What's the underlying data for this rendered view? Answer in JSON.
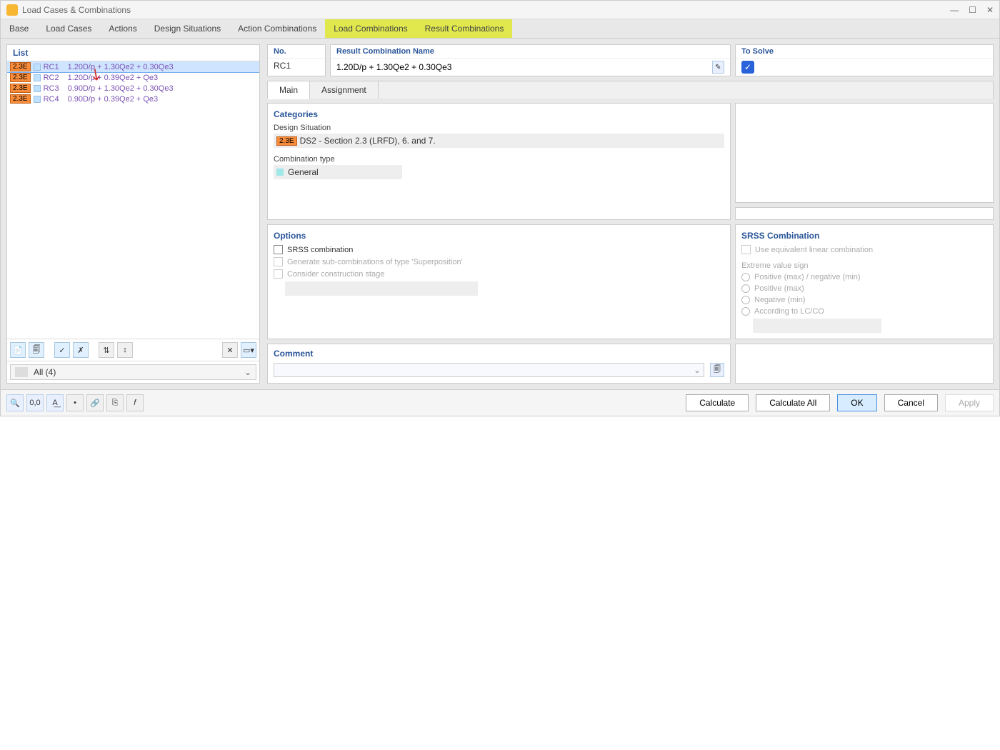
{
  "window_title": "Load Cases & Combinations",
  "main_tabs": [
    "Base",
    "Load Cases",
    "Actions",
    "Design Situations",
    "Action Combinations",
    "Load Combinations",
    "Result Combinations"
  ],
  "list": {
    "title": "List",
    "items": [
      {
        "badge": "2.3E",
        "id": "RC1",
        "desc": "1.20D/p + 1.30Qe2 + 0.30Qe3"
      },
      {
        "badge": "2.3E",
        "id": "RC2",
        "desc": "1.20D/p + 0.39Qe2 + Qe3"
      },
      {
        "badge": "2.3E",
        "id": "RC3",
        "desc": "0.90D/p + 1.30Qe2 + 0.30Qe3"
      },
      {
        "badge": "2.3E",
        "id": "RC4",
        "desc": "0.90D/p + 0.39Qe2 + Qe3"
      }
    ],
    "filter": "All (4)"
  },
  "header": {
    "no_label": "No.",
    "no_value": "RC1",
    "name_label": "Result Combination Name",
    "name_value": "1.20D/p + 1.30Qe2 + 0.30Qe3",
    "solve_label": "To Solve"
  },
  "sub_tabs": [
    "Main",
    "Assignment"
  ],
  "categories": {
    "title": "Categories",
    "ds_label": "Design Situation",
    "ds_badge": "2.3E",
    "ds_value": "DS2 - Section 2.3 (LRFD), 6. and 7.",
    "ct_label": "Combination type",
    "ct_value": "General"
  },
  "options": {
    "title": "Options",
    "srss": "SRSS combination",
    "gen_sub": "Generate sub-combinations of type 'Superposition'",
    "constr": "Consider construction stage"
  },
  "srss": {
    "title": "SRSS Combination",
    "equiv": "Use equivalent linear combination",
    "sign_label": "Extreme value sign",
    "opt1": "Positive (max) / negative (min)",
    "opt2": "Positive (max)",
    "opt3": "Negative (min)",
    "opt4": "According to LC/CO"
  },
  "comment_label": "Comment",
  "footer_buttons": {
    "calc": "Calculate",
    "calc_all": "Calculate All",
    "ok": "OK",
    "cancel": "Cancel",
    "apply": "Apply"
  }
}
